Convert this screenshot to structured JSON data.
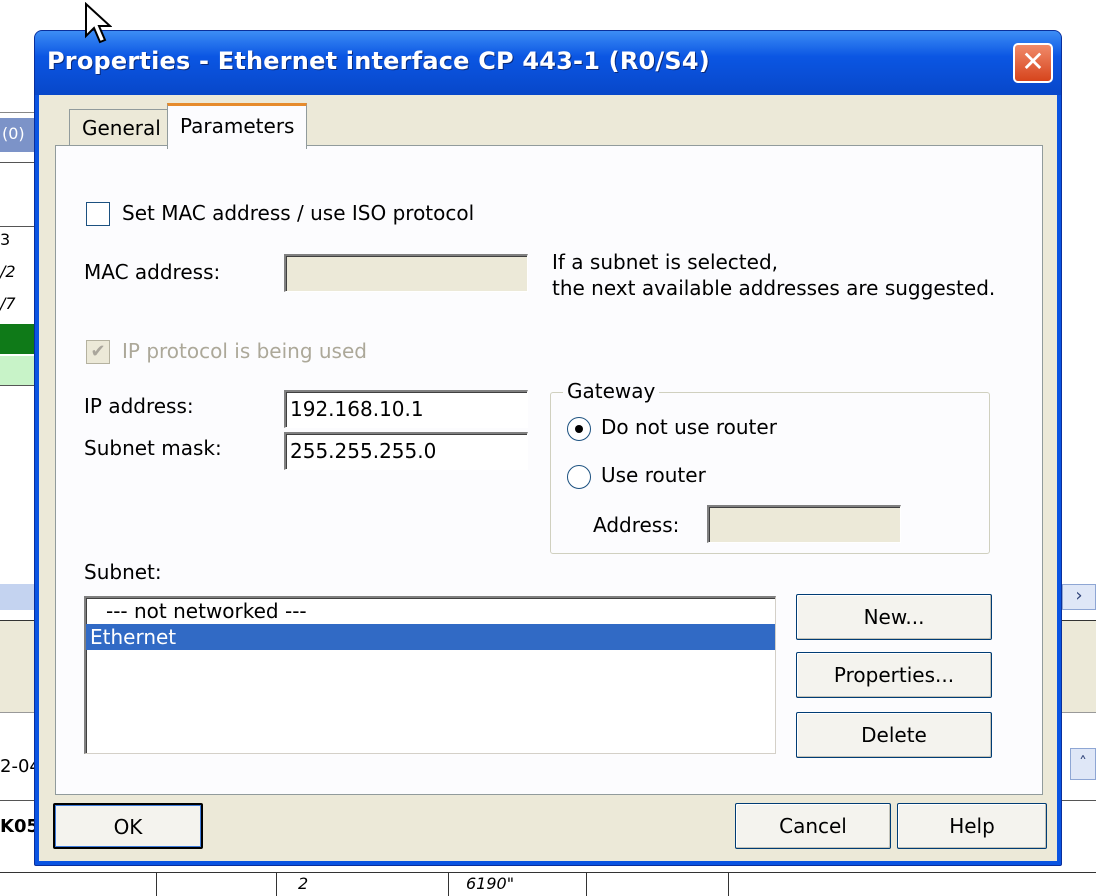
{
  "background": {
    "tab_label": "(0)",
    "cells": [
      "3",
      "/2",
      "/7"
    ],
    "lower_text": [
      "2-04",
      "K05"
    ],
    "bottom_cells": [
      "2",
      "6190\""
    ],
    "scroll_right": "›",
    "scroll_up": "˄"
  },
  "dialog": {
    "title": "Properties - Ethernet interface  CP 443-1 (R0/S4)",
    "close_symbol": "✕",
    "tabs": [
      {
        "label": "General",
        "active": false
      },
      {
        "label": "Parameters",
        "active": true
      }
    ],
    "mac": {
      "checkbox_label": "Set MAC address / use ISO protocol",
      "checked": false,
      "address_label": "MAC address:",
      "address_value": ""
    },
    "hint": {
      "line1": "If a subnet is selected,",
      "line2": "the next available addresses are suggested."
    },
    "ip_protocol": {
      "label": "IP protocol is being used",
      "checked": true,
      "check_mark": "✔"
    },
    "ip_address": {
      "label": "IP address:",
      "value": "192.168.10.1"
    },
    "subnet_mask": {
      "label": "Subnet mask:",
      "value": "255.255.255.0"
    },
    "gateway": {
      "title": "Gateway",
      "option_no_router": "Do not use router",
      "option_use_router": "Use router",
      "selected": "Do not use router",
      "address_label": "Address:",
      "address_value": ""
    },
    "subnet": {
      "label": "Subnet:",
      "items": [
        "--- not networked ---",
        "Ethernet"
      ],
      "selected": "Ethernet"
    },
    "side_buttons": {
      "new": "New...",
      "properties": "Properties...",
      "delete": "Delete"
    },
    "footer_buttons": {
      "ok": "OK",
      "cancel": "Cancel",
      "help": "Help"
    }
  }
}
